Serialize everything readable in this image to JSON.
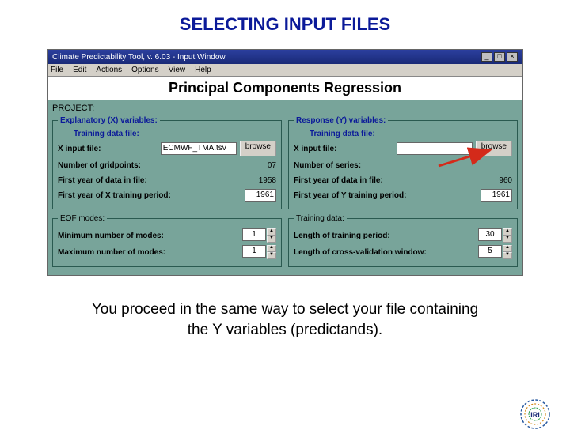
{
  "slide": {
    "title": "SELECTING INPUT FILES",
    "caption_line1": "You proceed in the same way to select your file containing",
    "caption_line2": "the Y variables (predictands)."
  },
  "window": {
    "title": "Climate Predictability Tool, v. 6.03 - Input Window",
    "min_label": "_",
    "max_label": "□",
    "close_label": "×"
  },
  "menu": {
    "file": "File",
    "edit": "Edit",
    "actions": "Actions",
    "options": "Options",
    "view": "View",
    "help": "Help"
  },
  "panel": {
    "heading": "Principal Components Regression",
    "project_label": "PROJECT:"
  },
  "x": {
    "legend": "Explanatory (X) variables:",
    "sublabel": "Training data file:",
    "input_file_label": "X input file:",
    "input_file_value": "ECMWF_TMA.tsv",
    "browse_label": "browse",
    "n_grid_label": "Number of gridpoints:",
    "n_grid_value": "07",
    "first_year_file_label": "First year of data in file:",
    "first_year_file_value": "1958",
    "first_year_train_label": "First year of X training period:",
    "first_year_train_value": "1961",
    "eof_legend": "EOF modes:",
    "min_modes_label": "Minimum number of modes:",
    "min_modes_value": "1",
    "max_modes_label": "Maximum number of modes:",
    "max_modes_value": "1"
  },
  "y": {
    "legend": "Response (Y) variables:",
    "sublabel": "Training data file:",
    "input_file_label": "X input file:",
    "input_file_value": "",
    "browse_label": "browse",
    "n_series_label": "Number of series:",
    "n_series_value": "",
    "first_year_file_label": "First year of data in file:",
    "first_year_file_value": "960",
    "first_year_train_label": "First year of Y training period:",
    "first_year_train_value": "1961",
    "train_legend": "Training data:",
    "train_len_label": "Length of training period:",
    "train_len_value": "30",
    "cv_len_label": "Length of cross-validation window:",
    "cv_len_value": "5"
  },
  "logo": {
    "text": "IRI"
  }
}
